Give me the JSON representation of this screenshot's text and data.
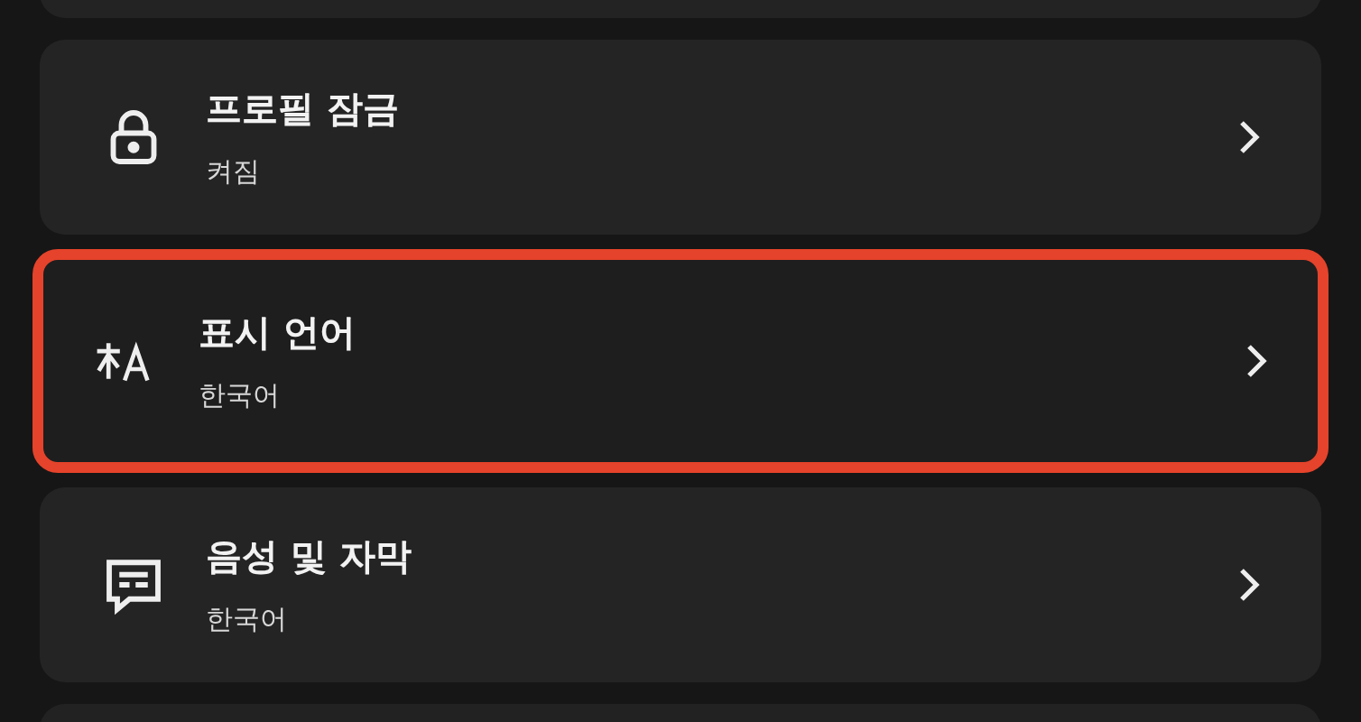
{
  "settings": [
    {
      "kind": "lock",
      "title": "프로필 잠금",
      "value": "켜짐",
      "highlighted": false
    },
    {
      "kind": "language",
      "title": "표시 언어",
      "value": "한국어",
      "highlighted": true
    },
    {
      "kind": "subtitles",
      "title": "음성 및 자막",
      "value": "한국어",
      "highlighted": false
    }
  ]
}
